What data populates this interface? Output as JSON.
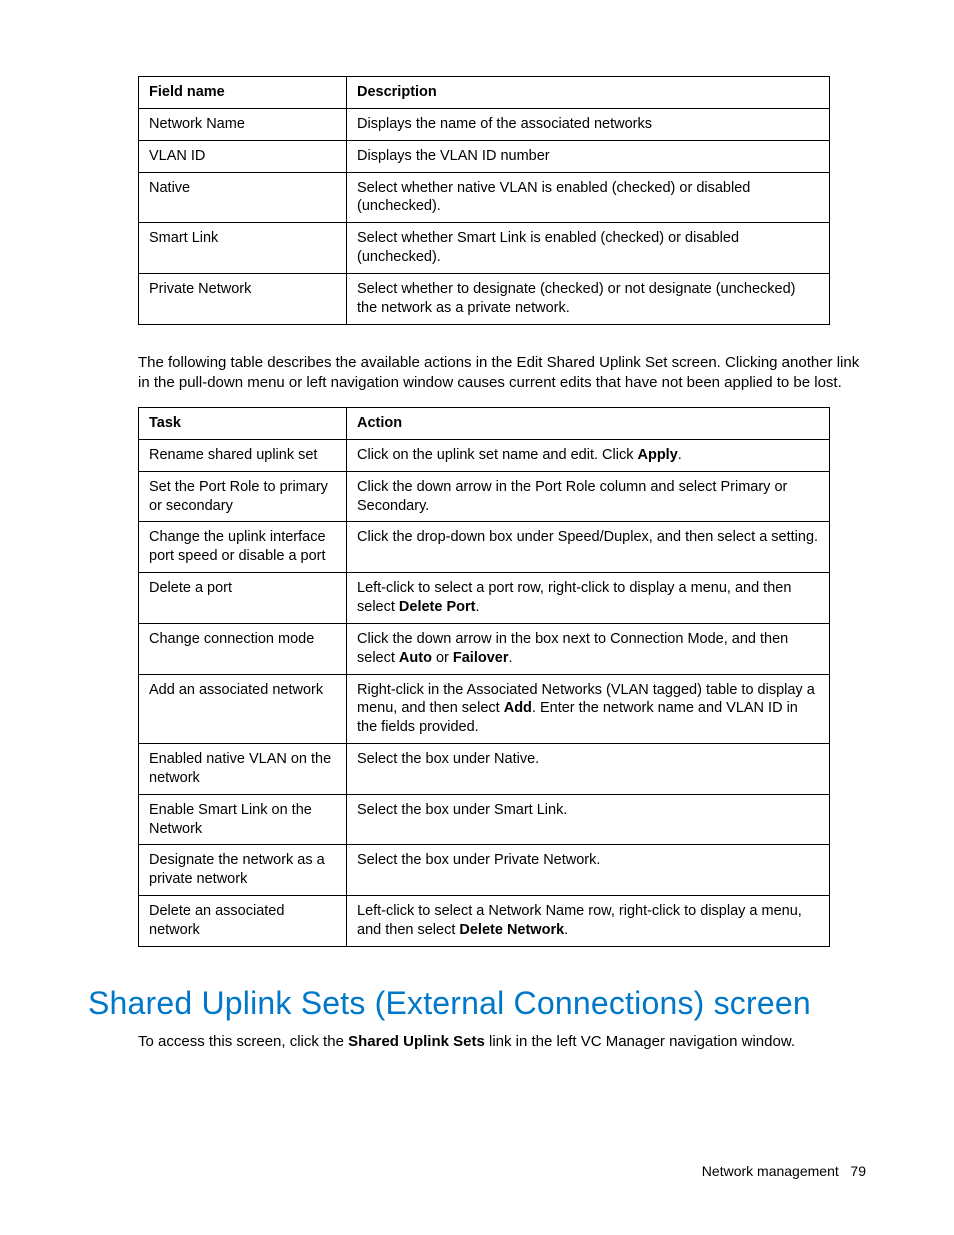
{
  "table1": {
    "headers": [
      "Field name",
      "Description"
    ],
    "rows": [
      {
        "field": "Network Name",
        "desc": "Displays the name of the associated networks"
      },
      {
        "field": "VLAN ID",
        "desc": "Displays the VLAN ID number"
      },
      {
        "field": "Native",
        "desc": "Select whether native VLAN is enabled (checked) or disabled (unchecked)."
      },
      {
        "field": "Smart Link",
        "desc": "Select whether Smart Link is enabled (checked) or disabled (unchecked)."
      },
      {
        "field": "Private Network",
        "desc": "Select whether to designate (checked) or not designate (unchecked) the network as a private network."
      }
    ]
  },
  "paragraph1": "The following table describes the available actions in the Edit Shared Uplink Set screen. Clicking another link in the pull-down menu or left navigation window causes current edits that have not been applied to be lost.",
  "table2": {
    "headers": [
      "Task",
      "Action"
    ],
    "rows": [
      {
        "task": "Rename shared uplink set",
        "action_parts": [
          "Click on the uplink set name and edit. Click ",
          {
            "b": "Apply"
          },
          "."
        ]
      },
      {
        "task": "Set the Port Role to primary or secondary",
        "action_parts": [
          "Click the down arrow in the Port Role column and select Primary or Secondary."
        ]
      },
      {
        "task": "Change the uplink interface port speed or disable a port",
        "action_parts": [
          "Click the drop-down box under Speed/Duplex, and then select a setting."
        ]
      },
      {
        "task": "Delete a port",
        "action_parts": [
          "Left-click to select a port row, right-click to display a menu, and then select ",
          {
            "b": "Delete Port"
          },
          "."
        ]
      },
      {
        "task": "Change connection mode",
        "action_parts": [
          "Click the down arrow in the box next to Connection Mode, and then select ",
          {
            "b": "Auto"
          },
          " or ",
          {
            "b": "Failover"
          },
          "."
        ]
      },
      {
        "task": "Add an associated network",
        "action_parts": [
          "Right-click in the Associated Networks (VLAN tagged) table to display a menu, and then select ",
          {
            "b": "Add"
          },
          ". Enter the network name and VLAN ID in the fields provided."
        ]
      },
      {
        "task": "Enabled native VLAN on the network",
        "action_parts": [
          "Select the box under Native."
        ]
      },
      {
        "task": "Enable Smart Link on the Network",
        "action_parts": [
          "Select the box under Smart Link."
        ]
      },
      {
        "task": "Designate the network as a private network",
        "action_parts": [
          "Select the box under Private Network."
        ]
      },
      {
        "task": "Delete an associated network",
        "action_parts": [
          "Left-click to select a Network Name row, right-click to display a menu, and then select ",
          {
            "b": "Delete Network"
          },
          "."
        ]
      }
    ]
  },
  "heading": "Shared Uplink Sets (External Connections) screen",
  "access_parts": [
    "To access this screen, click the ",
    {
      "b": "Shared Uplink Sets"
    },
    " link in the left VC Manager navigation window."
  ],
  "footer": {
    "section": "Network management",
    "page": "79"
  }
}
